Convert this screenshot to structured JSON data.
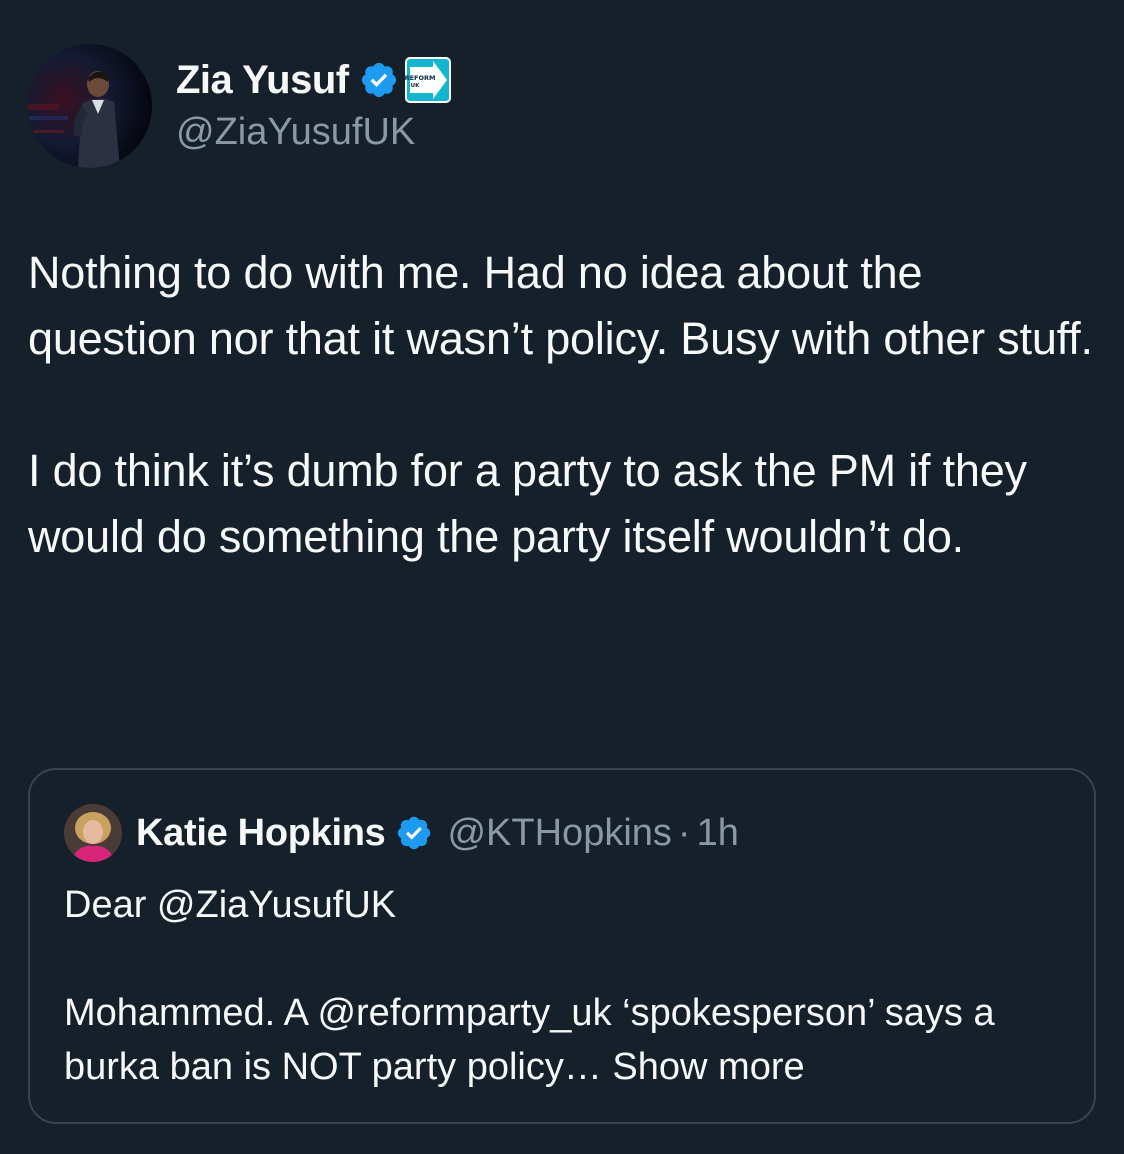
{
  "tweet": {
    "author_name": "Zia Yusuf",
    "author_handle": "@ZiaYusufUK",
    "affiliate_badge_text": "REFORM UK",
    "text_paragraphs": [
      "Nothing to do with me. Had no idea about the question nor that it wasn’t policy. Busy with other stuff.",
      "I do think it’s dumb for a party to ask the PM if they would do something the party itself wouldn’t do."
    ]
  },
  "quote": {
    "author_name": "Katie Hopkins",
    "author_handle": "@KTHopkins",
    "separator": "·",
    "time": "1h",
    "text_paragraphs": [
      "Dear @ZiaYusufUK",
      "Mohammed. A @reformparty_uk ‘spokesperson’ says a burka ban is NOT party policy…"
    ],
    "show_more_label": "Show more"
  },
  "icons": {
    "verified": "verified-badge-icon",
    "affiliate": "reform-uk-badge-icon"
  },
  "colors": {
    "background": "#15202b",
    "text_primary": "#f7f9f9",
    "text_secondary": "#8b98a5",
    "verified_blue": "#1d9bf0",
    "border": "#38444d",
    "reform_cyan": "#12b6cf"
  }
}
